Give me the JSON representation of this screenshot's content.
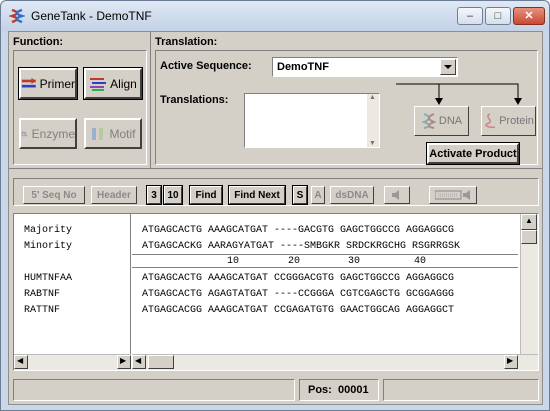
{
  "window": {
    "title": "GeneTank - DemoTNF",
    "controls": [
      "minimize",
      "maximize",
      "close"
    ]
  },
  "function_panel": {
    "label": "Function:",
    "buttons": [
      {
        "label": "Primer",
        "icon": "primer-icon",
        "enabled": true
      },
      {
        "label": "Align",
        "icon": "align-icon",
        "enabled": true
      },
      {
        "label": "Enzyme",
        "icon": "enzyme-icon",
        "enabled": false
      },
      {
        "label": "Motif",
        "icon": "motif-icon",
        "enabled": false
      }
    ]
  },
  "translation_panel": {
    "label": "Translation:",
    "active_sequence_label": "Active Sequence:",
    "active_sequence_value": "DemoTNF",
    "translations_label": "Translations:",
    "dna_label": "DNA",
    "protein_label": "Protein",
    "activate_button": "Activate Product"
  },
  "toolbar": {
    "seq_no": "5' Seq No",
    "header": "Header",
    "num3": "3",
    "num10": "10",
    "find": "Find",
    "find_next": "Find Next",
    "s": "S",
    "a": "A",
    "dsdna": "dsDNA"
  },
  "alignment": {
    "names": [
      "Majority",
      "Minority",
      "",
      "HUMTNFAA",
      "RABTNF",
      "RATTNF"
    ],
    "rows": [
      "ATGAGCACTG AAAGCATGAT ----GACGTG GAGCTGGCCG AGGAGGCG",
      "ATGAGCACKG AARAGYATGAT ----SMBGKR SRDCKRGCHG RSGRRGSK",
      "",
      "ATGAGCACTG AAAGCATGAT CCGGGACGTG GAGCTGGCCG AGGAGGCG",
      "ATGAGCACTG AGAGTATGAT ----CCGGGA CGTCGAGCTG GCGGAGGG",
      "ATGAGCACGG AAAGCATGAT CCGAGATGTG GAACTGGCAG AGGAGGCT"
    ],
    "ruler": [
      "10",
      "20",
      "30",
      "40"
    ]
  },
  "status": {
    "pos_label": "Pos:",
    "pos_value": "00001"
  }
}
